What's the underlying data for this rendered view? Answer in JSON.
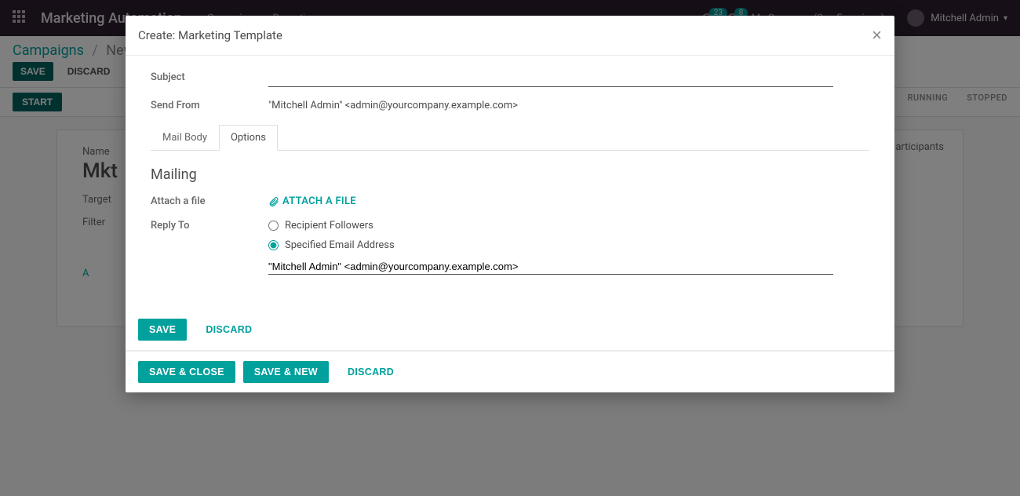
{
  "navbar": {
    "app_title": "Marketing Automation",
    "links": [
      "Campaigns",
      "Reporting"
    ],
    "clock_badge": "23",
    "chat_badge": "8",
    "company": "My Company (San Francisco)",
    "user": "Mitchell Admin"
  },
  "breadcrumb": {
    "root": "Campaigns",
    "current": "New"
  },
  "buttons": {
    "save": "SAVE",
    "discard": "DISCARD",
    "start": "START"
  },
  "status_bar": [
    "RUNNING",
    "STOPPED"
  ],
  "bg_form": {
    "participants": "articipants",
    "name_label": "Name",
    "name_val": "Mkt",
    "target_label": "Target",
    "filter_label": "Filter",
    "add_link": "A"
  },
  "modal": {
    "title": "Create: Marketing Template",
    "subject_label": "Subject",
    "subject_value": "",
    "sendfrom_label": "Send From",
    "sendfrom_value": "\"Mitchell Admin\" <admin@yourcompany.example.com>",
    "tabs": {
      "mail_body": "Mail Body",
      "options": "Options"
    },
    "section_mailing": "Mailing",
    "attach_label": "Attach a file",
    "attach_link": "ATTACH A FILE",
    "reply_to_label": "Reply To",
    "reply_opt_followers": "Recipient Followers",
    "reply_opt_specified": "Specified Email Address",
    "reply_value": "\"Mitchell Admin\" <admin@yourcompany.example.com>",
    "actions": {
      "save": "SAVE",
      "discard": "DISCARD",
      "save_close": "SAVE & CLOSE",
      "save_new": "SAVE & NEW"
    }
  }
}
